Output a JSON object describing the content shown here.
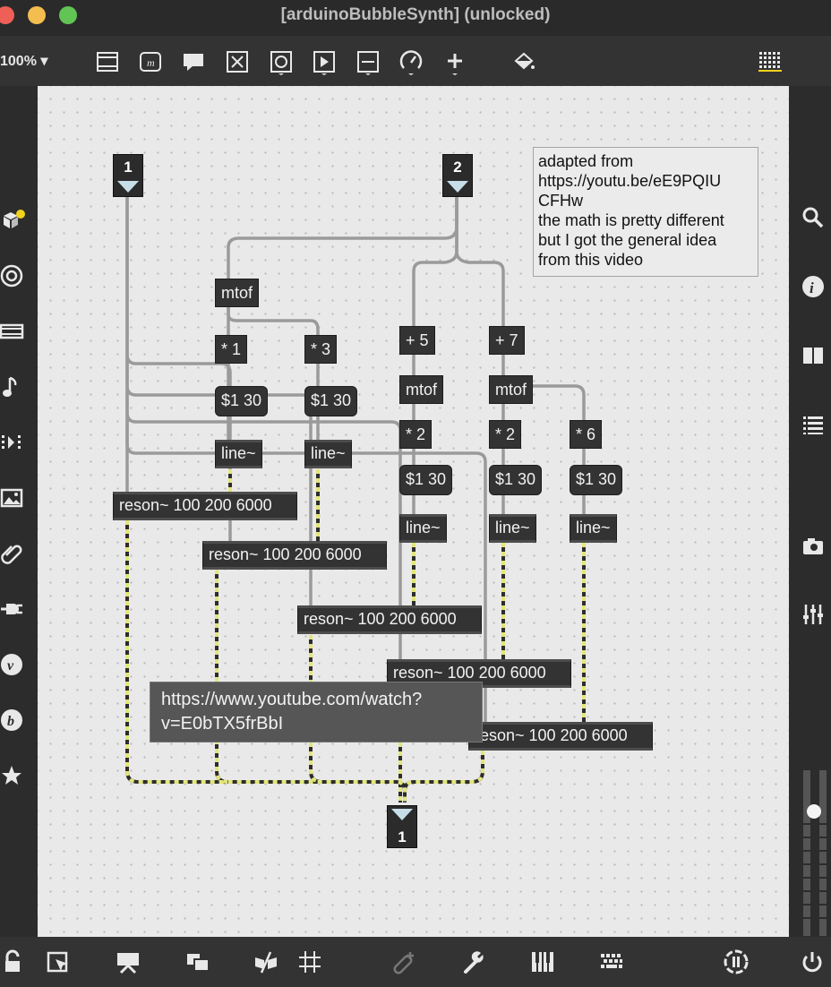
{
  "window": {
    "title": "[arduinoBubbleSynth] (unlocked)"
  },
  "toolbar": {
    "zoom": "100% ▾",
    "tools": [
      "comment-box-icon",
      "message-icon",
      "speech-bubble-icon",
      "toggle-icon",
      "button-icon",
      "play-icon",
      "slider-icon",
      "dial-icon",
      "plus-icon",
      "paint-bucket-icon",
      "grid-keyboard-icon"
    ]
  },
  "sidebar_left": [
    "package-manager-icon",
    "target-icon",
    "media-icon",
    "music-note-icon",
    "sequence-icon",
    "image-icon",
    "paperclip-icon",
    "plug-icon",
    "vst-icon",
    "b-icon",
    "star-icon"
  ],
  "sidebar_right": [
    "search-icon",
    "info-icon",
    "split-view-icon",
    "list-icon",
    "camera-icon",
    "mixer-icon"
  ],
  "bottom": [
    "lock-icon",
    "select-icon",
    "presentation-icon",
    "layers-icon",
    "debug-icon",
    "grid-icon",
    "add-object-icon",
    "wrench-icon",
    "keyboard-icon",
    "keyboard-grid-icon",
    "audio-icon",
    "power-icon"
  ],
  "patch": {
    "inlet1": "1",
    "inlet2": "2",
    "outlet1": "1",
    "comment": "adapted from\nhttps://youtu.be/eE9PQIU\nCFHw\nthe math is pretty different\nbut I got the general idea\nfrom this video",
    "mtof1": "mtof",
    "mul1": "* 1",
    "mul3": "* 3",
    "msg1": "$1 30",
    "msg3": "$1 30",
    "line1": "line~",
    "line3": "line~",
    "add5": "+ 5",
    "add7": "+ 7",
    "mtof5": "mtof",
    "mtof7": "mtof",
    "mul2a": "* 2",
    "mul2b": "* 2",
    "mul6": "* 6",
    "msg5": "$1 30",
    "msg7": "$1 30",
    "msg6": "$1 30",
    "line5": "line~",
    "line7": "line~",
    "line6": "line~",
    "reson1": "reson~ 100 200 6000",
    "reson2": "reson~ 100 200 6000",
    "reson3": "reson~ 100 200 6000",
    "reson4": "reson~ 100 200 6000",
    "reson5": "reson~ 100 200 6000"
  },
  "tooltip": {
    "line1": "https://www.youtube.com/watch?",
    "line2": "v=E0bTX5frBbI"
  }
}
